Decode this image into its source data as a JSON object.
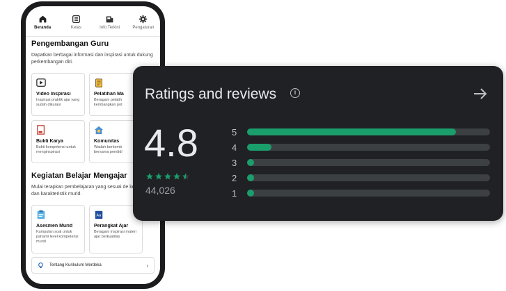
{
  "phone": {
    "nav": [
      {
        "label": "Beranda",
        "icon": "home-icon",
        "active": true
      },
      {
        "label": "Kelas",
        "icon": "class-icon",
        "active": false
      },
      {
        "label": "Info Terkini",
        "icon": "news-icon",
        "active": false
      },
      {
        "label": "Pengaturan",
        "icon": "gear-icon",
        "active": false
      }
    ],
    "section1": {
      "title": "Pengembangan Guru",
      "desc": "Dapatkan berbagai informasi dan inspirasi untuk dukung perkembangan diri.",
      "cards": [
        {
          "title": "Video Inspirasi",
          "desc": "Inspirasi praktik ajar yang sudah dikurasi",
          "icon": "video-icon"
        },
        {
          "title": "Pelatihan Ma",
          "desc": "Beragam pelatih kembangkan pot",
          "icon": "training-icon"
        },
        {
          "title": "Bukti Karya",
          "desc": "Bukti kompetensi untuk menginspirasi",
          "icon": "portfolio-icon"
        },
        {
          "title": "Komunitas",
          "desc": "Wadah berkemb bersama pendidi",
          "icon": "community-icon"
        }
      ]
    },
    "section2": {
      "title": "Kegiatan Belajar Mengajar",
      "desc": "Mulai terapkan pembelajaran yang sesuai de kebutuhan dan karakteristik murid.",
      "cards": [
        {
          "title": "Asesmen Murid",
          "desc": "Kumpulan soal untuk pahami level kompetensi murid",
          "icon": "assessment-icon"
        },
        {
          "title": "Perangkat Ajar",
          "desc": "Beragam inspirasi materi ajar berkualitas",
          "icon": "teaching-kit-icon"
        }
      ]
    },
    "kurikulum": {
      "label": "Tentang Kurikulum Merdeka",
      "icon": "lightbulb-icon"
    }
  },
  "ratings": {
    "title": "Ratings and reviews",
    "info_icon": "info-icon",
    "arrow_icon": "arrow-right-icon",
    "score": "4.8",
    "stars": 4.5,
    "count": "44,026",
    "accent": "#1a9e6c",
    "distribution": [
      {
        "label": "5",
        "fraction": 0.86
      },
      {
        "label": "4",
        "fraction": 0.1
      },
      {
        "label": "3",
        "fraction": 0.02
      },
      {
        "label": "2",
        "fraction": 0.01
      },
      {
        "label": "1",
        "fraction": 0.02
      }
    ]
  }
}
